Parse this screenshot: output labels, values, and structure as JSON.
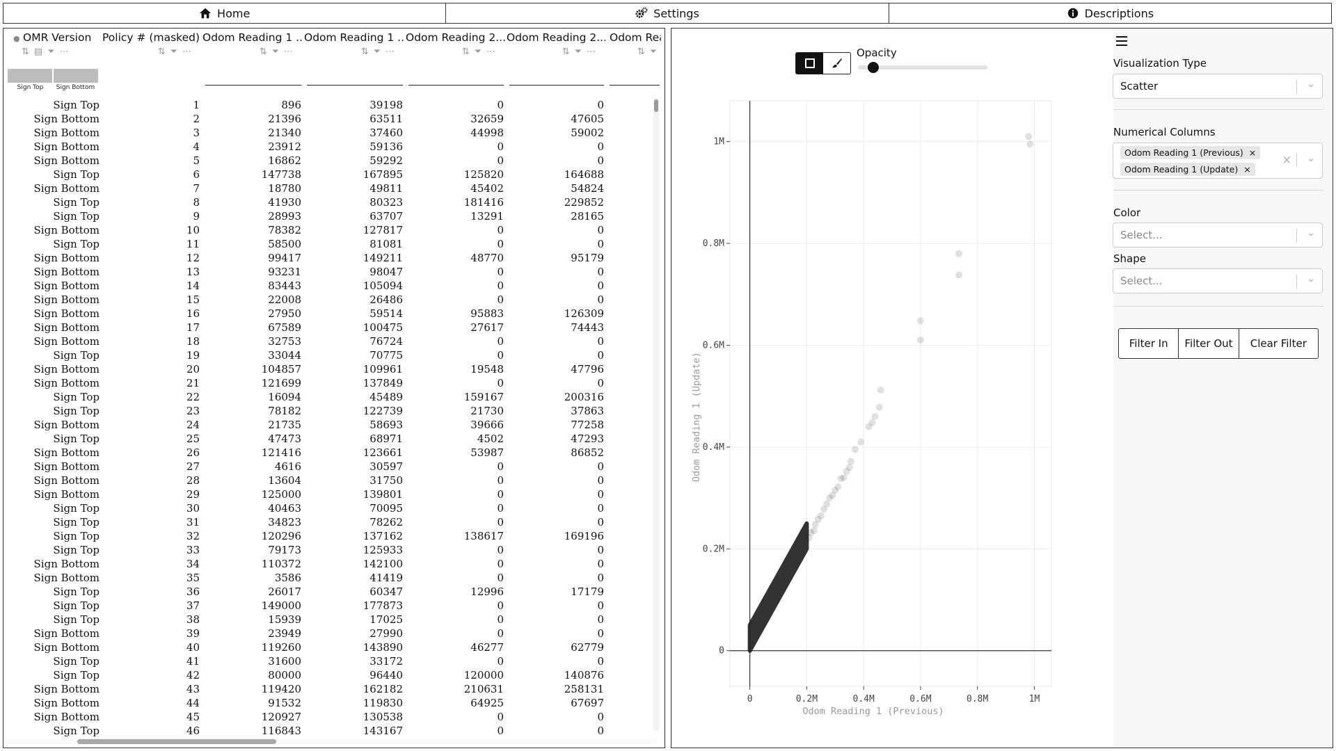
{
  "nav": {
    "tabs": [
      {
        "label": "Home",
        "icon": "home-icon"
      },
      {
        "label": "Settings",
        "icon": "gears-icon"
      },
      {
        "label": "Descriptions",
        "icon": "info-icon"
      }
    ]
  },
  "table": {
    "columns": [
      "OMR Version",
      "Policy # (masked)",
      "Odom Reading 1 ...",
      "Odom Reading 1 ...",
      "Odom Reading 2...",
      "Odom Reading 2...",
      "Odom Rea"
    ],
    "hist_labels": [
      "Sign Top",
      "Sign Bottom"
    ],
    "rows": [
      [
        "Sign Top",
        "1",
        "896",
        "39198",
        "0",
        "0"
      ],
      [
        "Sign Bottom",
        "2",
        "21396",
        "63511",
        "32659",
        "47605"
      ],
      [
        "Sign Bottom",
        "3",
        "21340",
        "37460",
        "44998",
        "59002"
      ],
      [
        "Sign Bottom",
        "4",
        "23912",
        "59136",
        "0",
        "0"
      ],
      [
        "Sign Bottom",
        "5",
        "16862",
        "59292",
        "0",
        "0"
      ],
      [
        "Sign Top",
        "6",
        "147738",
        "167895",
        "125820",
        "164688"
      ],
      [
        "Sign Bottom",
        "7",
        "18780",
        "49811",
        "45402",
        "54824"
      ],
      [
        "Sign Top",
        "8",
        "41930",
        "80323",
        "181416",
        "229852"
      ],
      [
        "Sign Top",
        "9",
        "28993",
        "63707",
        "13291",
        "28165"
      ],
      [
        "Sign Bottom",
        "10",
        "78382",
        "127817",
        "0",
        "0"
      ],
      [
        "Sign Top",
        "11",
        "58500",
        "81081",
        "0",
        "0"
      ],
      [
        "Sign Bottom",
        "12",
        "99417",
        "149211",
        "48770",
        "95179"
      ],
      [
        "Sign Bottom",
        "13",
        "93231",
        "98047",
        "0",
        "0"
      ],
      [
        "Sign Bottom",
        "14",
        "83443",
        "105094",
        "0",
        "0"
      ],
      [
        "Sign Bottom",
        "15",
        "22008",
        "26486",
        "0",
        "0"
      ],
      [
        "Sign Bottom",
        "16",
        "27950",
        "59514",
        "95883",
        "126309"
      ],
      [
        "Sign Bottom",
        "17",
        "67589",
        "100475",
        "27617",
        "74443"
      ],
      [
        "Sign Bottom",
        "18",
        "32753",
        "76724",
        "0",
        "0"
      ],
      [
        "Sign Top",
        "19",
        "33044",
        "70775",
        "0",
        "0"
      ],
      [
        "Sign Bottom",
        "20",
        "104857",
        "109961",
        "19548",
        "47796"
      ],
      [
        "Sign Bottom",
        "21",
        "121699",
        "137849",
        "0",
        "0"
      ],
      [
        "Sign Top",
        "22",
        "16094",
        "45489",
        "159167",
        "200316"
      ],
      [
        "Sign Top",
        "23",
        "78182",
        "122739",
        "21730",
        "37863"
      ],
      [
        "Sign Bottom",
        "24",
        "21735",
        "58693",
        "39666",
        "77258"
      ],
      [
        "Sign Top",
        "25",
        "47473",
        "68971",
        "4502",
        "47293"
      ],
      [
        "Sign Bottom",
        "26",
        "121416",
        "123661",
        "53987",
        "86852"
      ],
      [
        "Sign Bottom",
        "27",
        "4616",
        "30597",
        "0",
        "0"
      ],
      [
        "Sign Bottom",
        "28",
        "13604",
        "31750",
        "0",
        "0"
      ],
      [
        "Sign Bottom",
        "29",
        "125000",
        "139801",
        "0",
        "0"
      ],
      [
        "Sign Top",
        "30",
        "40463",
        "70095",
        "0",
        "0"
      ],
      [
        "Sign Top",
        "31",
        "34823",
        "78262",
        "0",
        "0"
      ],
      [
        "Sign Top",
        "32",
        "120296",
        "137162",
        "138617",
        "169196"
      ],
      [
        "Sign Top",
        "33",
        "79173",
        "125933",
        "0",
        "0"
      ],
      [
        "Sign Bottom",
        "34",
        "110372",
        "142100",
        "0",
        "0"
      ],
      [
        "Sign Bottom",
        "35",
        "3586",
        "41419",
        "0",
        "0"
      ],
      [
        "Sign Top",
        "36",
        "26017",
        "60347",
        "12996",
        "17179"
      ],
      [
        "Sign Top",
        "37",
        "149000",
        "177873",
        "0",
        "0"
      ],
      [
        "Sign Top",
        "38",
        "15939",
        "17025",
        "0",
        "0"
      ],
      [
        "Sign Bottom",
        "39",
        "23949",
        "27990",
        "0",
        "0"
      ],
      [
        "Sign Bottom",
        "40",
        "119260",
        "143890",
        "46277",
        "62779"
      ],
      [
        "Sign Top",
        "41",
        "31600",
        "33172",
        "0",
        "0"
      ],
      [
        "Sign Top",
        "42",
        "80000",
        "96440",
        "120000",
        "140876"
      ],
      [
        "Sign Bottom",
        "43",
        "119420",
        "162182",
        "210631",
        "258131"
      ],
      [
        "Sign Bottom",
        "44",
        "91532",
        "119830",
        "64925",
        "67697"
      ],
      [
        "Sign Bottom",
        "45",
        "120927",
        "130538",
        "0",
        "0"
      ],
      [
        "Sign Top",
        "46",
        "116843",
        "143167",
        "0",
        "0"
      ]
    ]
  },
  "chart_controls": {
    "opacity_label": "Opacity",
    "opacity_value": 0.1
  },
  "chart_data": {
    "type": "scatter",
    "xlabel": "Odom Reading 1 (Previous)",
    "ylabel": "Odom Reading 1 (Update)",
    "xlim": [
      -70000,
      1060000
    ],
    "ylim": [
      -70000,
      1080000
    ],
    "xticks": [
      0,
      200000,
      400000,
      600000,
      800000,
      1000000
    ],
    "xtick_labels": [
      "0",
      "0.2M",
      "0.4M",
      "0.6M",
      "0.8M",
      "1M"
    ],
    "yticks": [
      0,
      200000,
      400000,
      600000,
      800000,
      1000000
    ],
    "ytick_labels": [
      "0",
      "0.2M",
      "0.4M",
      "0.6M",
      "0.8M",
      "1M"
    ],
    "grid": true,
    "point_color": "#222222",
    "dense_band": {
      "x_from": 0,
      "x_to": 200000,
      "y_offset_min": 0,
      "y_offset_max": 50000
    },
    "outliers": [
      [
        980000,
        1010000
      ],
      [
        985000,
        995000
      ],
      [
        735000,
        780000
      ],
      [
        735000,
        738000
      ],
      [
        600000,
        648000
      ],
      [
        600000,
        610000
      ],
      [
        460000,
        512000
      ],
      [
        455000,
        478000
      ],
      [
        440000,
        460000
      ],
      [
        430000,
        448000
      ],
      [
        418000,
        440000
      ],
      [
        390000,
        410000
      ],
      [
        370000,
        395000
      ],
      [
        355000,
        372000
      ],
      [
        350000,
        360000
      ],
      [
        340000,
        352000
      ],
      [
        330000,
        340000
      ],
      [
        320000,
        338000
      ],
      [
        310000,
        322000
      ],
      [
        300000,
        315000
      ],
      [
        290000,
        305000
      ],
      [
        280000,
        300000
      ],
      [
        270000,
        288000
      ],
      [
        260000,
        278000
      ],
      [
        250000,
        265000
      ],
      [
        240000,
        258000
      ],
      [
        230000,
        248000
      ],
      [
        225000,
        236000
      ],
      [
        215000,
        232000
      ],
      [
        208000,
        222000
      ]
    ]
  },
  "controls": {
    "viz_type_label": "Visualization Type",
    "viz_type_value": "Scatter",
    "numerical_label": "Numerical Columns",
    "numerical_tags": [
      "Odom Reading 1 (Previous)",
      "Odom Reading 1 (Update)"
    ],
    "color_label": "Color",
    "color_placeholder": "Select...",
    "shape_label": "Shape",
    "shape_placeholder": "Select...",
    "filter_in": "Filter In",
    "filter_out": "Filter Out",
    "clear_filter": "Clear Filter"
  }
}
